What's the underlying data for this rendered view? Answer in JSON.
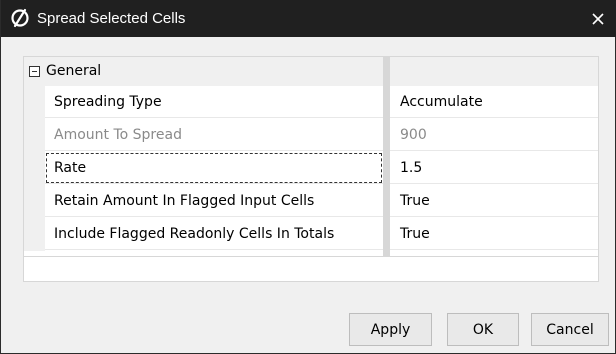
{
  "window": {
    "title": "Spread Selected Cells",
    "logo_icon": "logo-icon",
    "close_icon": "close-icon"
  },
  "grid": {
    "category": {
      "label": "General",
      "expander_icon": "collapse-icon"
    },
    "rows": [
      {
        "name": "Spreading Type",
        "value": "Accumulate",
        "disabled": false,
        "focused": false
      },
      {
        "name": "Amount To Spread",
        "value": "900",
        "disabled": true,
        "focused": false
      },
      {
        "name": "Rate",
        "value": "1.5",
        "disabled": false,
        "focused": true
      },
      {
        "name": "Retain Amount In Flagged Input Cells",
        "value": "True",
        "disabled": false,
        "focused": false
      },
      {
        "name": "Include Flagged Readonly Cells In Totals",
        "value": "True",
        "disabled": false,
        "focused": false
      }
    ]
  },
  "buttons": {
    "apply": "Apply",
    "ok": "OK",
    "cancel": "Cancel"
  }
}
